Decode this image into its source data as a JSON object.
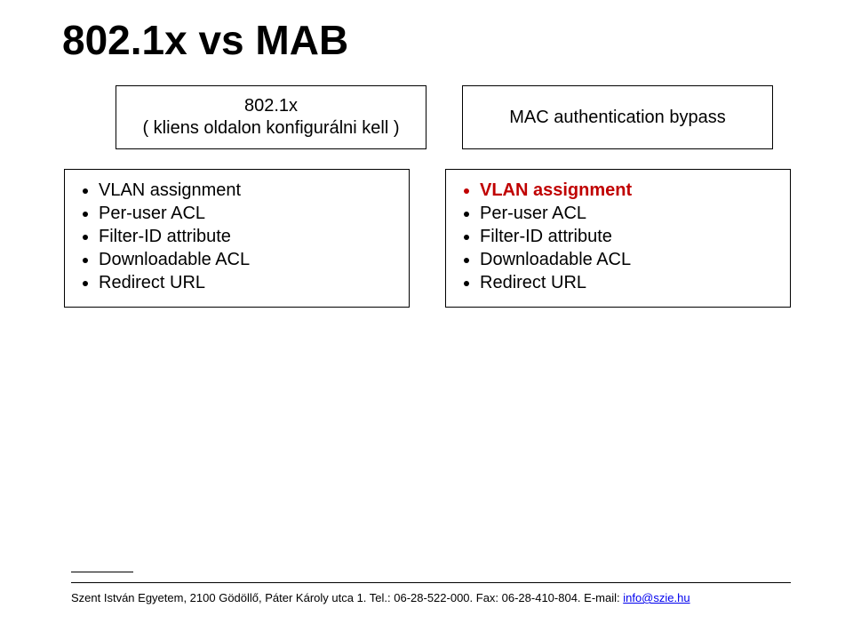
{
  "title": "802.1x vs MAB",
  "headers": {
    "left_line1": "802.1x",
    "left_line2": "( kliens oldalon konfigurálni kell )",
    "right": "MAC authentication bypass"
  },
  "left_list": {
    "items": [
      "VLAN assignment",
      "Per-user ACL",
      "Filter-ID attribute",
      "Downloadable ACL",
      "Redirect URL"
    ]
  },
  "right_list": {
    "items": [
      "VLAN assignment",
      "Per-user ACL",
      "Filter-ID attribute",
      "Downloadable ACL",
      "Redirect URL"
    ],
    "highlight_index": 0
  },
  "footer": {
    "text_prefix": "Szent István Egyetem, 2100 Gödöllő, Páter Károly utca 1. Tel.: 06-28-522-000. Fax: 06-28-410-804. E-mail: ",
    "link_text": "info@szie.hu"
  }
}
